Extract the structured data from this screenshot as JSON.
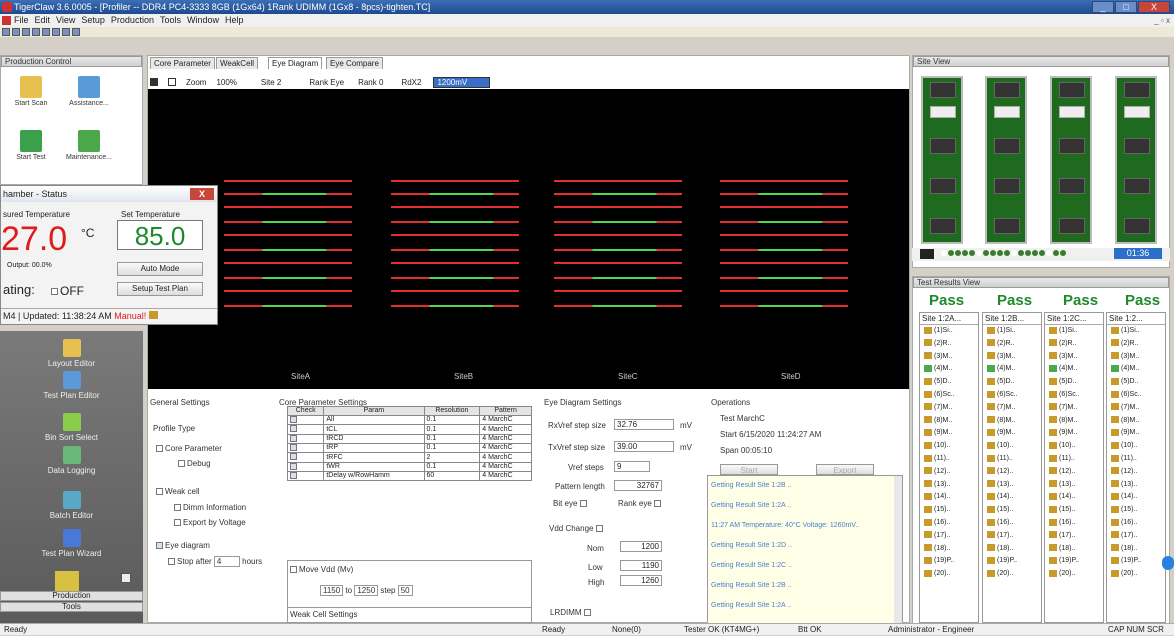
{
  "window": {
    "title": "TigerClaw 3.6.0005 - [Profiler -- DDR4 PC4-3333 8GB (1Gx64) 1Rank UDIMM (1Gx8 - 8pcs)-tighten.TC]",
    "min": "_",
    "max": "□",
    "close": "X"
  },
  "menu": [
    "File",
    "Edit",
    "View",
    "Setup",
    "Production",
    "Tools",
    "Window",
    "Help"
  ],
  "mdi_controls": "_ ▫ x",
  "production_control": {
    "title": "Production Control",
    "buttons": [
      "Start Scan",
      "Assistance...",
      "Start Test",
      "Maintenance..."
    ]
  },
  "nav": {
    "items": [
      "Layout Editor",
      "Test Plan Editor",
      "Bin Sort Select",
      "Data Logging",
      "Batch Editor",
      "Test Plan Wizard"
    ],
    "tabs": [
      "Production",
      "Tools"
    ]
  },
  "chamber": {
    "title": "hamber - Status",
    "measured_label": "sured Temperature",
    "set_label": "Set Temperature",
    "measured_value": "27.0",
    "unit": "°C",
    "set_value": "85.0",
    "output": "Output: 00.0%",
    "auto_mode": "Auto Mode",
    "heating": "ating:",
    "off": "OFF",
    "setup_plan": "Setup Test Plan",
    "footer_id": "M4",
    "updated": "Updated: 11:38:24 AM",
    "manual": "Manual!"
  },
  "tabs": [
    "Core Parameter",
    "WeakCell",
    "Eye Diagram",
    "Eye Compare"
  ],
  "eye_toolbar": {
    "zoom_label": "Zoom",
    "zoom": "100%",
    "site": "Site 2",
    "rank_eye": "Rank Eye",
    "rank": "Rank 0",
    "rdx": "RdX2",
    "mv": "1200mV"
  },
  "sites": [
    "SiteA",
    "SiteB",
    "SiteC",
    "SiteD"
  ],
  "general_settings": {
    "title": "General Settings",
    "profile_type": "Profile Type",
    "core_param": "Core Parameter",
    "debug": "Debug",
    "weak_cell": "Weak cell",
    "dimm_info": "Dimm Information",
    "export": "Export by Voltage",
    "eye_diagram": "Eye diagram",
    "stop_after": "Stop after",
    "stop_val": "4",
    "hours": "hours"
  },
  "core_settings": {
    "title": "Core Parameter Settings",
    "headers": [
      "Check",
      "Param",
      "Resolution",
      "Pattern"
    ],
    "rows": [
      [
        "All",
        "0.1",
        "4 MarchC"
      ],
      [
        "tCL",
        "0.1",
        "4 MarchC"
      ],
      [
        "tRCD",
        "0.1",
        "4 MarchC"
      ],
      [
        "tRP",
        "0.1",
        "4 MarchC"
      ],
      [
        "tRFC",
        "2",
        "4 MarchC"
      ],
      [
        "tWR",
        "0.1",
        "4 MarchC"
      ],
      [
        "tDelay w/RowHamm",
        "60",
        "4 MarchC"
      ]
    ],
    "move_vdd": "Move Vdd (Mv)",
    "from": "1150",
    "to": "to",
    "to_val": "1250",
    "step": "step",
    "step_val": "50",
    "weak_title": "Weak Cell Settings"
  },
  "eye_settings": {
    "title": "Eye Diagram Settings",
    "rx_label": "RxVref step size",
    "rx_val": "32.76",
    "tx_label": "TxVref step size",
    "tx_val": "39.00",
    "mv": "mV",
    "vref_label": "Vref steps",
    "vref_val": "9",
    "pattern_label": "Pattern length",
    "pattern_val": "32767",
    "bit_eye": "Bit eye",
    "rank_eye": "Rank eye",
    "vdd_change": "Vdd Change",
    "nom": "Nom",
    "nom_val": "1200",
    "low": "Low",
    "low_val": "1190",
    "high": "High",
    "high_val": "1260",
    "lrdimm": "LRDIMM"
  },
  "operations": {
    "title": "Operations",
    "test_label": "Test",
    "test_val": "MarchC",
    "start_label": "Start",
    "start_val": "6/15/2020 11:24:27 AM",
    "span_label": "Span",
    "span_val": "00:05:10",
    "btn1": "Start",
    "btn2": "Export"
  },
  "log": [
    "Getting Result Site 1:2B ..",
    "Getting Result Site 1:2A ..",
    "11:27 AM Temperature: 40°C Voltage: 1260mV..",
    "Getting Result Site 1:2D ..",
    "Getting Result Site 1:2C ..",
    "Getting Result Site 1:2B ..",
    "Getting Result Site 1:2A .."
  ],
  "site_view": {
    "title": "Site View",
    "timer": "01:36"
  },
  "test_results": {
    "title": "Test Results View",
    "pass": [
      "Pass",
      "Pass",
      "Pass",
      "Pass"
    ],
    "columns": [
      "Site 1:2A...",
      "Site 1:2B...",
      "Site 1:2C...",
      "Site 1:2..."
    ],
    "rows": [
      "(1)Si..",
      "(2)R..",
      "(3)M..",
      "(4)M..",
      "(5)D..",
      "(6)Sc..",
      "(7)M..",
      "(8)M..",
      "(9)M..",
      "(10)..",
      "(11)..",
      "(12)..",
      "(13)..",
      "(14)..",
      "(15)..",
      "(16)..",
      "(17)..",
      "(18)..",
      "(19)P..",
      "(20).."
    ]
  },
  "status": {
    "ready": "Ready",
    "ready2": "Ready",
    "none": "None(0)",
    "tester": "Tester OK (KT4MG+)",
    "btt": "Btt OK",
    "user": "Administrator - Engineer",
    "caps": "CAP NUM SCR"
  }
}
